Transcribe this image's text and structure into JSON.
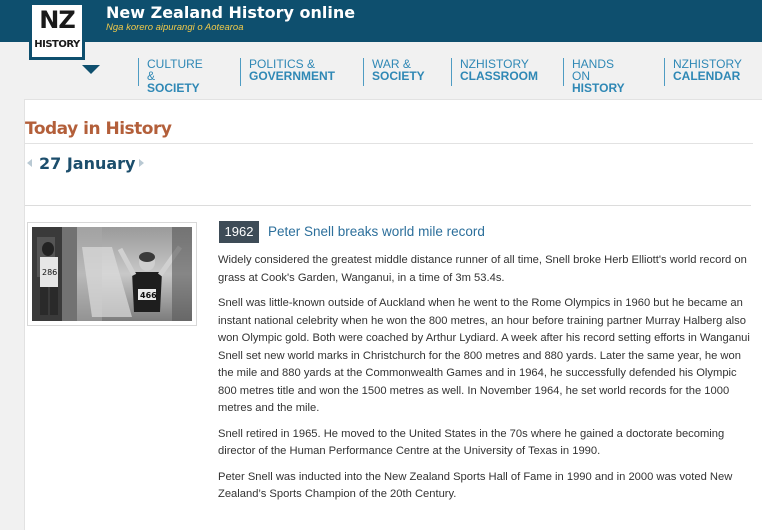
{
  "header": {
    "site_title": "New Zealand History online",
    "site_subtitle": "Nga korero aipurangi o Aotearoa",
    "logo": {
      "top": "NZ",
      "bottom": "HISTORY"
    }
  },
  "nav": [
    {
      "top": "CULTURE &",
      "bottom": "SOCIETY"
    },
    {
      "top": "POLITICS &",
      "bottom": "GOVERNMENT"
    },
    {
      "top": "WAR &",
      "bottom": "SOCIETY"
    },
    {
      "top": "NZHISTORY",
      "bottom": "CLASSROOM"
    },
    {
      "top": "HANDS ON",
      "bottom": "HISTORY"
    },
    {
      "top": "NZHISTORY",
      "bottom": "CALENDAR"
    }
  ],
  "section": {
    "title": "Today in History"
  },
  "date": {
    "label": "27 January",
    "prev_icon": "triangle-left",
    "next_icon": "triangle-right"
  },
  "event": {
    "year": "1962",
    "headline": "Peter Snell breaks world mile record",
    "photo_alt": "runner",
    "paragraphs": [
      "Widely considered the greatest middle distance runner of all time, Snell broke Herb Elliott's world record on grass at Cook's Garden, Wanganui, in a time of 3m 53.4s.",
      "Snell was little-known outside of Auckland when he went to the Rome Olympics in 1960 but he became an instant national celebrity when he won the 800 metres, an hour before training partner Murray Halberg also won Olympic gold. Both were coached by Arthur Lydiard. A week after his record setting efforts in Wanganui Snell set new world marks in Christchurch for the 800 metres and 880 yards. Later the same year, he won the mile and 880 yards at the Commonwealth Games and in 1964, he successfully defended his Olympic 800 metres title and won the 1500 metres as well. In November 1964, he set world records for the 1000 metres and the mile.",
      "Snell retired in 1965. He moved to the United States in the 70s where he gained a doctorate becoming director of the Human Performance Centre at the University of Texas in 1990.",
      "Peter Snell was inducted into the New Zealand Sports Hall of Fame in 1990 and in 2000 was voted New Zealand’s Sports Champion of the 20th Century."
    ]
  },
  "colors": {
    "header_bg": "#0e4f6e",
    "nav_text": "#2f88b5",
    "section_title": "#b35f3a",
    "date_text": "#1c4e6c",
    "headline": "#2c6f9b",
    "subtitle": "#f0c94a"
  }
}
